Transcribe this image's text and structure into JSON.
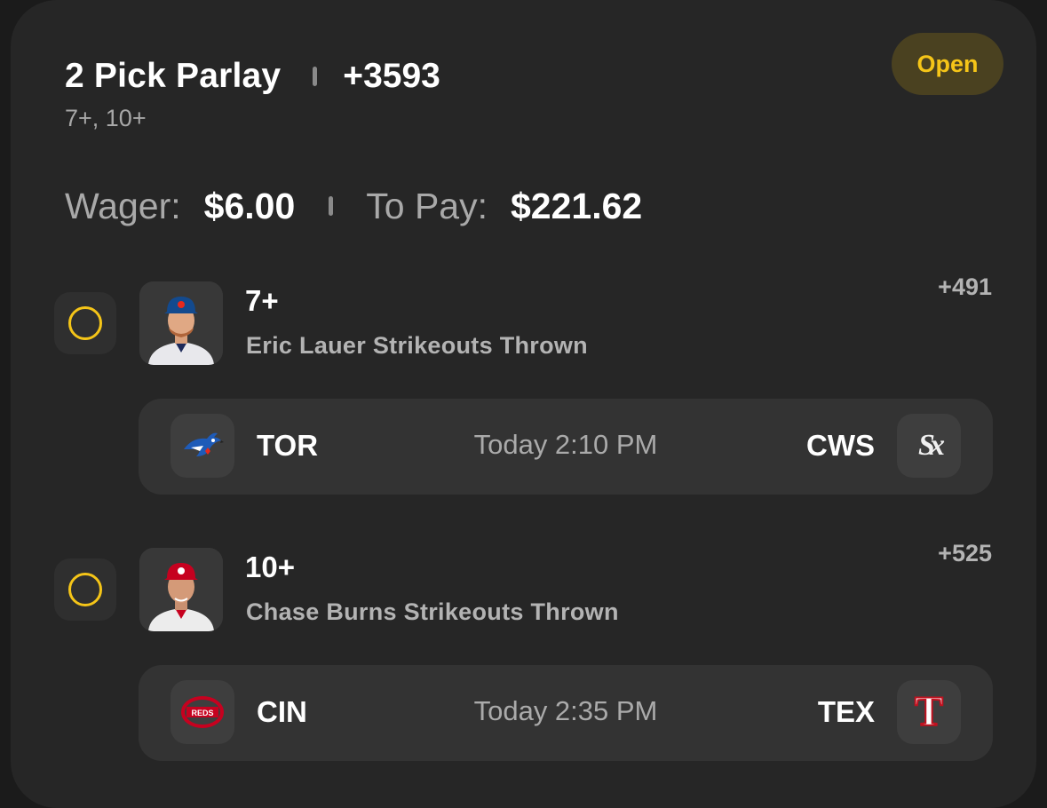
{
  "header": {
    "title": "2 Pick Parlay",
    "total_odds": "+3593",
    "subtitle": "7+, 10+",
    "status": "Open"
  },
  "wager": {
    "wager_label": "Wager:",
    "wager_value": "$6.00",
    "pay_label": "To Pay:",
    "pay_value": "$221.62"
  },
  "legs": [
    {
      "line": "7+",
      "market": "Eric Lauer Strikeouts Thrown",
      "odds": "+491",
      "game": {
        "home": "TOR",
        "time": "Today 2:10 PM",
        "away": "CWS"
      }
    },
    {
      "line": "10+",
      "market": "Chase Burns Strikeouts Thrown",
      "odds": "+525",
      "game": {
        "home": "CIN",
        "time": "Today 2:35 PM",
        "away": "TEX"
      }
    }
  ],
  "logos": {
    "cin_text": "REDS",
    "tex_text": "T",
    "cws_text": "Sx"
  },
  "colors": {
    "accent": "#f5c518",
    "badge_bg": "#4a4120",
    "card_bg": "#262626"
  }
}
